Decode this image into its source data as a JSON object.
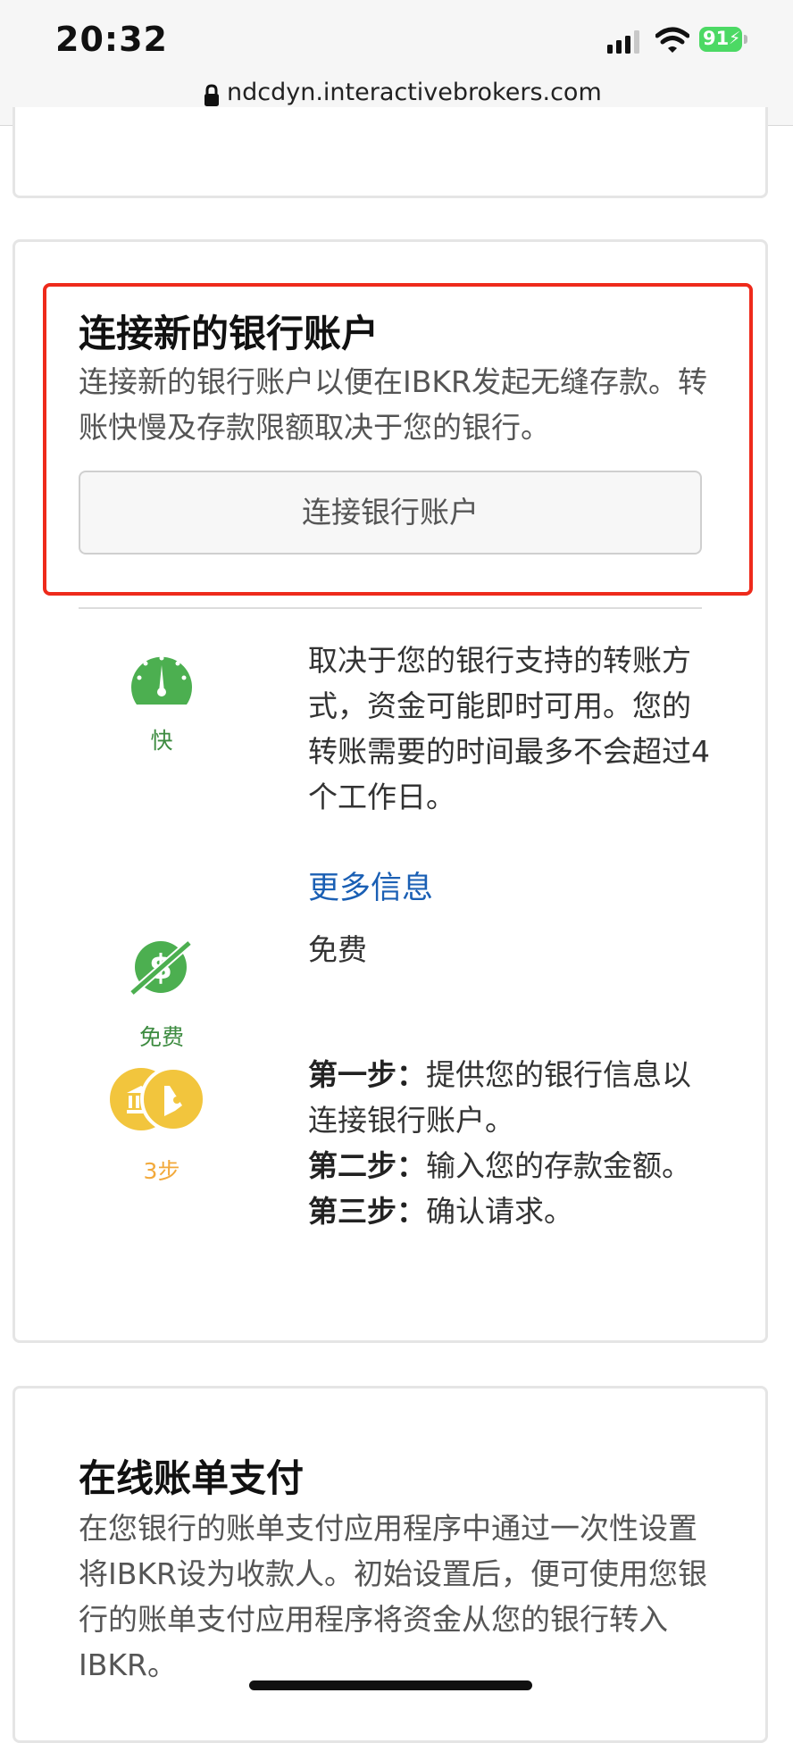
{
  "status_bar": {
    "time": "20:32",
    "battery": "91"
  },
  "browser": {
    "url": "ndcdyn.interactivebrokers.com"
  },
  "connect_section": {
    "title": "连接新的银行账户",
    "description": "连接新的银行账户以便在IBKR发起无缝存款。转账快慢及存款限额取决于您的银行。",
    "button_label": "连接银行账户"
  },
  "features": {
    "speed": {
      "label": "快",
      "text": "取决于您的银行支持的转账方式，资金可能即时可用。您的转账需要的时间最多不会超过4个工作日。",
      "link": "更多信息"
    },
    "cost": {
      "label": "免费",
      "text": "免费"
    },
    "steps": {
      "label": "3步",
      "step1_label": "第一步：",
      "step1_text": "提供您的银行信息以连接银行账户。",
      "step2_label": "第二步：",
      "step2_text": "输入您的存款金额。",
      "step3_label": "第三步：",
      "step3_text": "确认请求。"
    }
  },
  "bill_pay_section": {
    "title": "在线账单支付",
    "description": "在您银行的账单支付应用程序中通过一次性设置将IBKR设为收款人。初始设置后，便可使用您银行的账单支付应用程序将资金从您的银行转入IBKR。"
  },
  "colors": {
    "highlight": "#ee2a1b",
    "green": "#4caf50",
    "gold": "#f2c53d",
    "link": "#1a5fb4"
  }
}
